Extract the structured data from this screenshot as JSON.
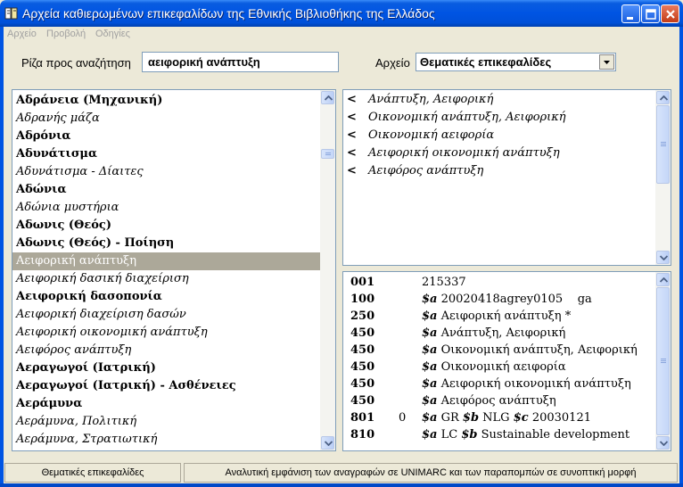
{
  "window": {
    "title": "Αρχεία καθιερωμένων επικεφαλίδων της Εθνικής Βιβλιοθήκης της Ελλάδος"
  },
  "menu": [
    "Αρχείο",
    "Προβολή",
    "Οδηγίες"
  ],
  "search": {
    "label": "Ρίζα προς αναζήτηση",
    "value": "αειφορική ανάπτυξη"
  },
  "file": {
    "label": "Αρχείο",
    "selected": "Θεματικές επικεφαλίδες"
  },
  "headings": [
    {
      "text": "Αδράνεια (Μηχανική)",
      "style": "b"
    },
    {
      "text": "Αδρανής μάζα",
      "style": "i"
    },
    {
      "text": "Αδρόνια",
      "style": "b"
    },
    {
      "text": "Αδυνάτισμα",
      "style": "b"
    },
    {
      "text": "Αδυνάτισμα - Δίαιτες",
      "style": "i"
    },
    {
      "text": "Αδώνια",
      "style": "b"
    },
    {
      "text": "Αδώνια μυστήρια",
      "style": "i"
    },
    {
      "text": "Αδωνις (Θεός)",
      "style": "b"
    },
    {
      "text": "Αδωνις (Θεός) - Ποίηση",
      "style": "b"
    },
    {
      "text": "Αειφορική ανάπτυξη",
      "style": "sel"
    },
    {
      "text": "Αειφορική δασική διαχείριση",
      "style": "i"
    },
    {
      "text": "Αειφορική δασοπονία",
      "style": "b"
    },
    {
      "text": "Αειφορική διαχείριση δασών",
      "style": "i"
    },
    {
      "text": "Αειφορική οικονομική ανάπτυξη",
      "style": "i"
    },
    {
      "text": "Αειφόρος ανάπτυξη",
      "style": "i"
    },
    {
      "text": "Αεραγωγοί (Ιατρική)",
      "style": "b"
    },
    {
      "text": "Αεραγωγοί (Ιατρική) - Ασθένειες",
      "style": "b"
    },
    {
      "text": "Αεράμυνα",
      "style": "b"
    },
    {
      "text": "Αεράμυνα, Πολιτική",
      "style": "i"
    },
    {
      "text": "Αεράμυνα, Στρατιωτική",
      "style": "i"
    }
  ],
  "references": [
    {
      "arrow": "<",
      "text": "Ανάπτυξη, Αειφορική"
    },
    {
      "arrow": "<",
      "text": "Οικονομική ανάπτυξη, Αειφορική"
    },
    {
      "arrow": "<",
      "text": "Οικονομική αειφορία"
    },
    {
      "arrow": "<",
      "text": "Αειφορική οικονομική ανάπτυξη"
    },
    {
      "arrow": "<",
      "text": "Αειφόρος ανάπτυξη"
    }
  ],
  "record": [
    {
      "tag": "001",
      "ind": "",
      "parts": [
        {
          "sf": "",
          "v": "215337"
        }
      ]
    },
    {
      "tag": "100",
      "ind": "",
      "parts": [
        {
          "sf": "$a",
          "v": " 20020418agrey0105    ga"
        }
      ]
    },
    {
      "tag": "250",
      "ind": "",
      "parts": [
        {
          "sf": "$a",
          "v": " Αειφορική ανάπτυξη *"
        }
      ]
    },
    {
      "tag": "450",
      "ind": "",
      "parts": [
        {
          "sf": "$a",
          "v": " Ανάπτυξη, Αειφορική"
        }
      ]
    },
    {
      "tag": "450",
      "ind": "",
      "parts": [
        {
          "sf": "$a",
          "v": " Οικονομική ανάπτυξη, Αειφορική"
        }
      ]
    },
    {
      "tag": "450",
      "ind": "",
      "parts": [
        {
          "sf": "$a",
          "v": " Οικονομική αειφορία"
        }
      ]
    },
    {
      "tag": "450",
      "ind": "",
      "parts": [
        {
          "sf": "$a",
          "v": " Αειφορική οικονομική ανάπτυξη"
        }
      ]
    },
    {
      "tag": "450",
      "ind": "",
      "parts": [
        {
          "sf": "$a",
          "v": " Αειφόρος ανάπτυξη"
        }
      ]
    },
    {
      "tag": "801",
      "ind": "0",
      "parts": [
        {
          "sf": "$a",
          "v": " GR "
        },
        {
          "sf": "$b",
          "v": " NLG "
        },
        {
          "sf": "$c",
          "v": " 20030121"
        }
      ]
    },
    {
      "tag": "810",
      "ind": "",
      "parts": [
        {
          "sf": "$a",
          "v": " LC "
        },
        {
          "sf": "$b",
          "v": " Sustainable development"
        }
      ]
    }
  ],
  "status": {
    "left": "Θεματικές επικεφαλίδες",
    "right": "Αναλυτική εμφάνιση των αναγραφών σε UNIMARC και των παραπομπών σε συνοπτική μορφή"
  },
  "colors": {
    "titlebar": "#0054e3",
    "selection": "#aca899",
    "face": "#ece9d8"
  },
  "icons": [
    "book-icon",
    "minimize-icon",
    "maximize-icon",
    "close-icon",
    "chevron-down-icon",
    "scroll-up-icon",
    "scroll-down-icon"
  ]
}
